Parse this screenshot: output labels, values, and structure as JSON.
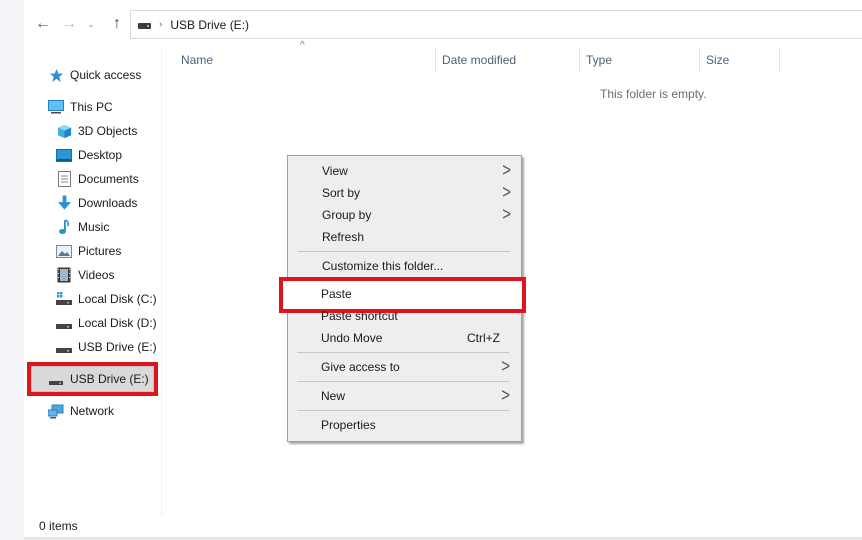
{
  "nav": {
    "back_icon": "arrow-left-icon",
    "forward_icon": "arrow-right-icon",
    "recent_icon": "chevron-down-icon",
    "up_icon": "arrow-up-icon",
    "back_glyph": "←",
    "forward_glyph": "→",
    "recent_glyph": "⌄",
    "up_glyph": "↑"
  },
  "address": {
    "separator": "›",
    "crumbs": [
      "USB Drive (E:)"
    ]
  },
  "sidebar": {
    "items": [
      {
        "label": "Quick access",
        "icon": "star-icon"
      },
      {
        "label": "This PC",
        "icon": "computer-icon"
      },
      {
        "label": "3D Objects",
        "icon": "cube-icon"
      },
      {
        "label": "Desktop",
        "icon": "desktop-icon"
      },
      {
        "label": "Documents",
        "icon": "document-icon"
      },
      {
        "label": "Downloads",
        "icon": "download-icon"
      },
      {
        "label": "Music",
        "icon": "music-icon"
      },
      {
        "label": "Pictures",
        "icon": "picture-icon"
      },
      {
        "label": "Videos",
        "icon": "video-icon"
      },
      {
        "label": "Local Disk (C:)",
        "icon": "system-drive-icon"
      },
      {
        "label": "Local Disk (D:)",
        "icon": "drive-icon"
      },
      {
        "label": "USB Drive (E:)",
        "icon": "drive-icon"
      },
      {
        "label": "USB Drive (E:)",
        "icon": "usb-drive-icon",
        "selected": true
      },
      {
        "label": "Network",
        "icon": "network-icon"
      }
    ]
  },
  "columns": [
    {
      "label": "Name"
    },
    {
      "label": "Date modified"
    },
    {
      "label": "Type"
    },
    {
      "label": "Size"
    }
  ],
  "sort_caret": "^",
  "empty_message": "This folder is empty.",
  "status": {
    "item_count": "0 items"
  },
  "context_menu": {
    "items": [
      {
        "label": "View",
        "submenu": true
      },
      {
        "label": "Sort by",
        "submenu": true
      },
      {
        "label": "Group by",
        "submenu": true
      },
      {
        "label": "Refresh"
      },
      {
        "label": "Customize this folder..."
      },
      {
        "label": "Paste",
        "highlighted": true
      },
      {
        "label": "Paste shortcut"
      },
      {
        "label": "Undo Move",
        "shortcut": "Ctrl+Z"
      },
      {
        "label": "Give access to",
        "submenu": true
      },
      {
        "label": "New",
        "submenu": true
      },
      {
        "label": "Properties"
      }
    ],
    "submenu_glyph": ">"
  },
  "colors": {
    "annotation_red": "#e0141b",
    "menu_bg": "#eeeeee",
    "header_text": "#4c607a",
    "selected_bg": "#d9d9d9"
  }
}
